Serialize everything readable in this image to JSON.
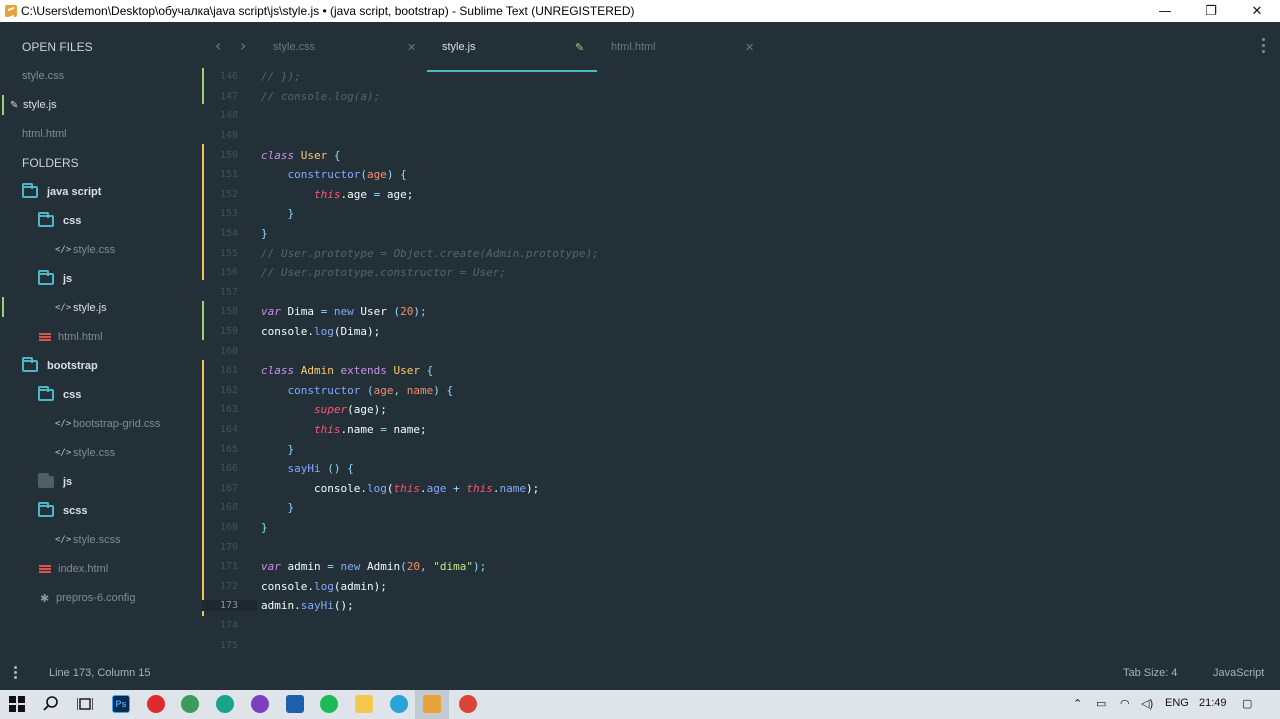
{
  "window": {
    "title": "C:\\Users\\demon\\Desktop\\обучалка\\java script\\js\\style.js • (java script, bootstrap) - Sublime Text (UNREGISTERED)",
    "minimize": "—",
    "restore": "❐",
    "close": "✕"
  },
  "sidebar": {
    "open_files_header": "OPEN FILES",
    "open_files": [
      {
        "label": "style.css"
      },
      {
        "label": "style.js",
        "active": true
      },
      {
        "label": "html.html"
      }
    ],
    "folders_header": "FOLDERS",
    "tree": [
      {
        "label": "java script"
      },
      {
        "label": "css"
      },
      {
        "label": "style.css"
      },
      {
        "label": "js"
      },
      {
        "label": "style.js"
      },
      {
        "label": "html.html"
      },
      {
        "label": "bootstrap"
      },
      {
        "label": "css"
      },
      {
        "label": "bootstrap-grid.css"
      },
      {
        "label": "style.css"
      },
      {
        "label": "js"
      },
      {
        "label": "scss"
      },
      {
        "label": "style.scss"
      },
      {
        "label": "index.html"
      },
      {
        "label": "prepros-6.config"
      }
    ]
  },
  "tabs": [
    {
      "label": "style.css",
      "active": false
    },
    {
      "label": "style.js",
      "active": true
    },
    {
      "label": "html.html",
      "active": false
    }
  ],
  "editor": {
    "line_numbers": [
      "146",
      "147",
      "148",
      "149",
      "150",
      "151",
      "152",
      "153",
      "154",
      "155",
      "156",
      "157",
      "158",
      "159",
      "160",
      "161",
      "162",
      "163",
      "164",
      "165",
      "166",
      "167",
      "168",
      "169",
      "170",
      "171",
      "172",
      "173",
      "174",
      "175"
    ],
    "current_line": "173",
    "code": {
      "l146": "// });",
      "l147": "// console.log(a);",
      "l155": "// User.prototype = Object.create(Admin.prototype);",
      "l156": "// User.prototype.constructor = User;",
      "kw_class": "class",
      "kw_var": "var",
      "kw_new": "new",
      "kw_extends": "extends",
      "kw_this": "this",
      "kw_super": "super",
      "cls_user": "User",
      "cls_admin": "Admin",
      "fn_constructor": "constructor",
      "fn_log": "log",
      "fn_sayhi": "sayHi",
      "txt_console": "console",
      "txt_dima": "Dima",
      "txt_admin": "admin",
      "txt_name": "name",
      "par_age": "age",
      "par_name": "name",
      "num_20": "20",
      "str_dima": "\"dima\"",
      "txt_age": "age"
    }
  },
  "status": {
    "position": "Line 173, Column 15",
    "tab_size": "Tab Size: 4",
    "syntax": "JavaScript"
  },
  "taskbar": {
    "ps_label": "Ps",
    "lang": "ENG",
    "time": "21:49"
  },
  "colors": {
    "background": "#243038",
    "accent": "#4fb6c7",
    "modified_bar": "#f0c05a",
    "added_bar": "#9ad36b"
  }
}
